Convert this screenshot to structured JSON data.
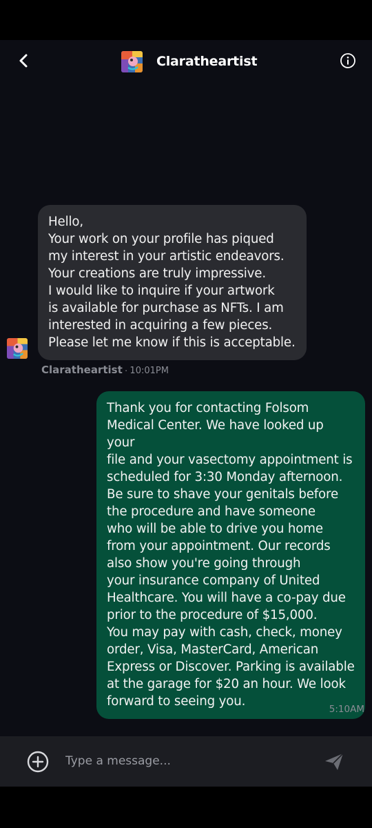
{
  "colors": {
    "background": "#0c0d14",
    "incoming_bubble": "#2a2b30",
    "outgoing_bubble": "#05503a",
    "meta_text": "#8a8c94",
    "composer_bar": "#1c1d22"
  },
  "header": {
    "title": "Claratheartist",
    "back_icon": "chevron-left-icon",
    "info_icon": "info-circle-icon"
  },
  "messages": [
    {
      "direction": "incoming",
      "text": "Hello,\nYour work on your profile has piqued\nmy interest in your artistic endeavors.\nYour creations are truly impressive.\nI would like to inquire if your artwork\nis available for purchase as NFTs. I am\ninterested in acquiring a few pieces.\nPlease let me know if this is acceptable.",
      "sender": "Claratheartist",
      "separator": "·",
      "time": "10:01PM"
    },
    {
      "direction": "outgoing",
      "text": "Thank you for contacting Folsom\nMedical Center. We have looked up your\nfile and your vasectomy appointment is\nscheduled for 3:30 Monday afternoon.\nBe sure to shave your genitals before\nthe procedure and have someone\nwho will be able to drive you home\nfrom your appointment. Our records\nalso show you're going through\nyour insurance company of United\nHealthcare. You will have a co-pay due\nprior to the procedure of $15,000.\nYou may pay with cash, check, money\norder, Visa, MasterCard, American\nExpress or Discover. Parking is available\nat the garage for $20 an hour. We look\nforward to seeing you.",
      "time": "5:10AM"
    }
  ],
  "composer": {
    "placeholder": "Type a message...",
    "add_icon": "plus-circle-icon",
    "send_icon": "send-icon"
  }
}
